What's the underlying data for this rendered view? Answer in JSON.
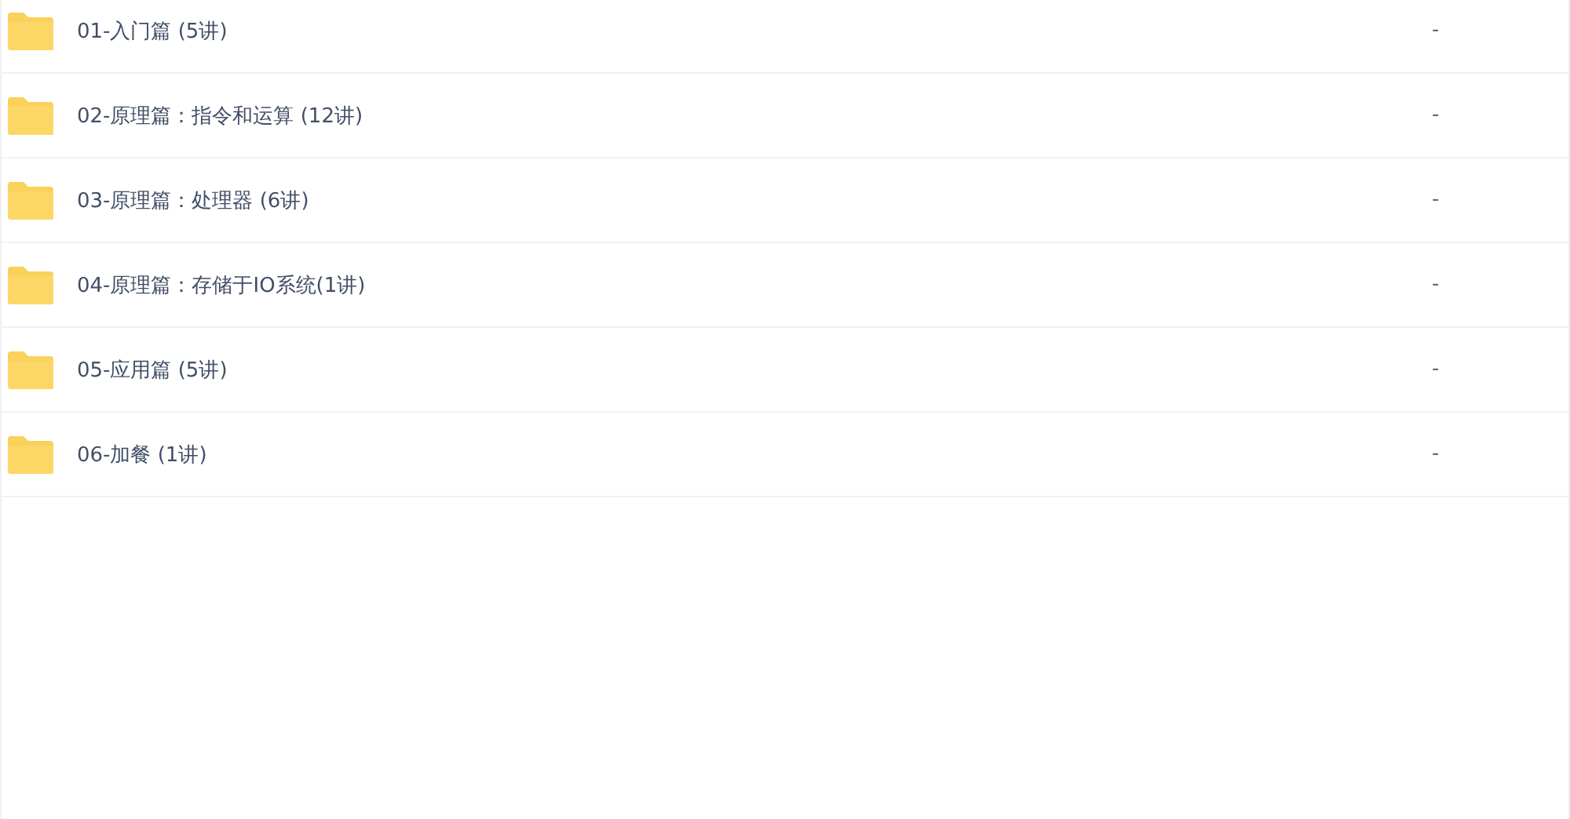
{
  "files": [
    {
      "name": "01-入门篇 (5讲)",
      "size": "-"
    },
    {
      "name": "02-原理篇：指令和运算 (12讲)",
      "size": "-"
    },
    {
      "name": "03-原理篇：处理器 (6讲)",
      "size": "-"
    },
    {
      "name": "04-原理篇：存储于IO系统(1讲)",
      "size": "-"
    },
    {
      "name": "05-应用篇 (5讲)",
      "size": "-"
    },
    {
      "name": "06-加餐 (1讲)",
      "size": "-"
    }
  ]
}
